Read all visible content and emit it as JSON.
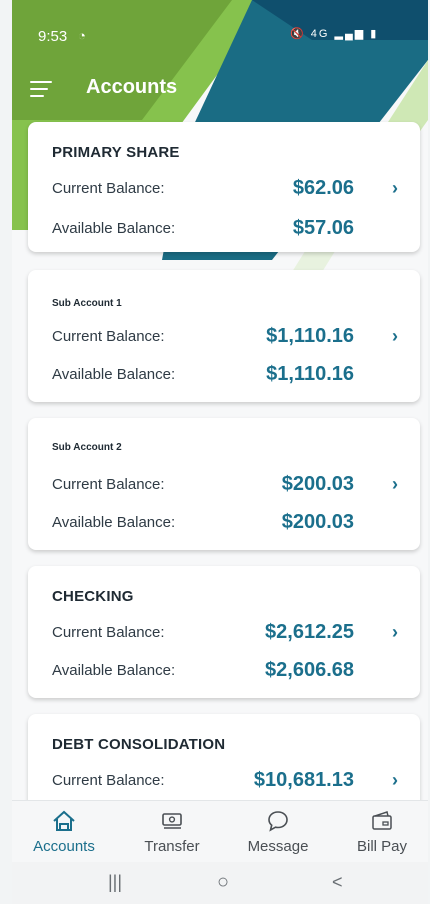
{
  "status_bar": {
    "time": "9:53",
    "icons": "◔",
    "signal": "🔇 4G ▂▄▆ ▮"
  },
  "app_bar": {
    "title": "Accounts"
  },
  "colors": {
    "accent": "#1b6f8c",
    "teal_dark": "#0f4f6d",
    "green": "#7cc04a"
  },
  "accounts": [
    {
      "title": "PRIMARY SHARE",
      "title_style": "bold",
      "current_label": "Current Balance:",
      "current": "$62.06",
      "available_label": "Available Balance:",
      "available": "$57.06"
    },
    {
      "title": "Sub Account 1",
      "title_style": "small",
      "current_label": "Current Balance:",
      "current": "$1,110.16",
      "available_label": "Available Balance:",
      "available": "$1,110.16"
    },
    {
      "title": "Sub Account 2",
      "title_style": "small",
      "current_label": "Current Balance:",
      "current": "$200.03",
      "available_label": "Available Balance:",
      "available": "$200.03"
    },
    {
      "title": "CHECKING",
      "title_style": "bold",
      "current_label": "Current Balance:",
      "current": "$2,612.25",
      "available_label": "Available Balance:",
      "available": "$2,606.68"
    },
    {
      "title": "DEBT CONSOLIDATION",
      "title_style": "bold",
      "current_label": "Current Balance:",
      "current": "$10,681.13"
    }
  ],
  "bottom_nav": [
    {
      "label": "Accounts",
      "icon": "home-icon",
      "active": true
    },
    {
      "label": "Transfer",
      "icon": "money-icon",
      "active": false
    },
    {
      "label": "Message",
      "icon": "chat-icon",
      "active": false
    },
    {
      "label": "Bill Pay",
      "icon": "bill-icon",
      "active": false
    }
  ],
  "system_nav": {
    "recents": "|||",
    "home": "○",
    "back": "<"
  }
}
